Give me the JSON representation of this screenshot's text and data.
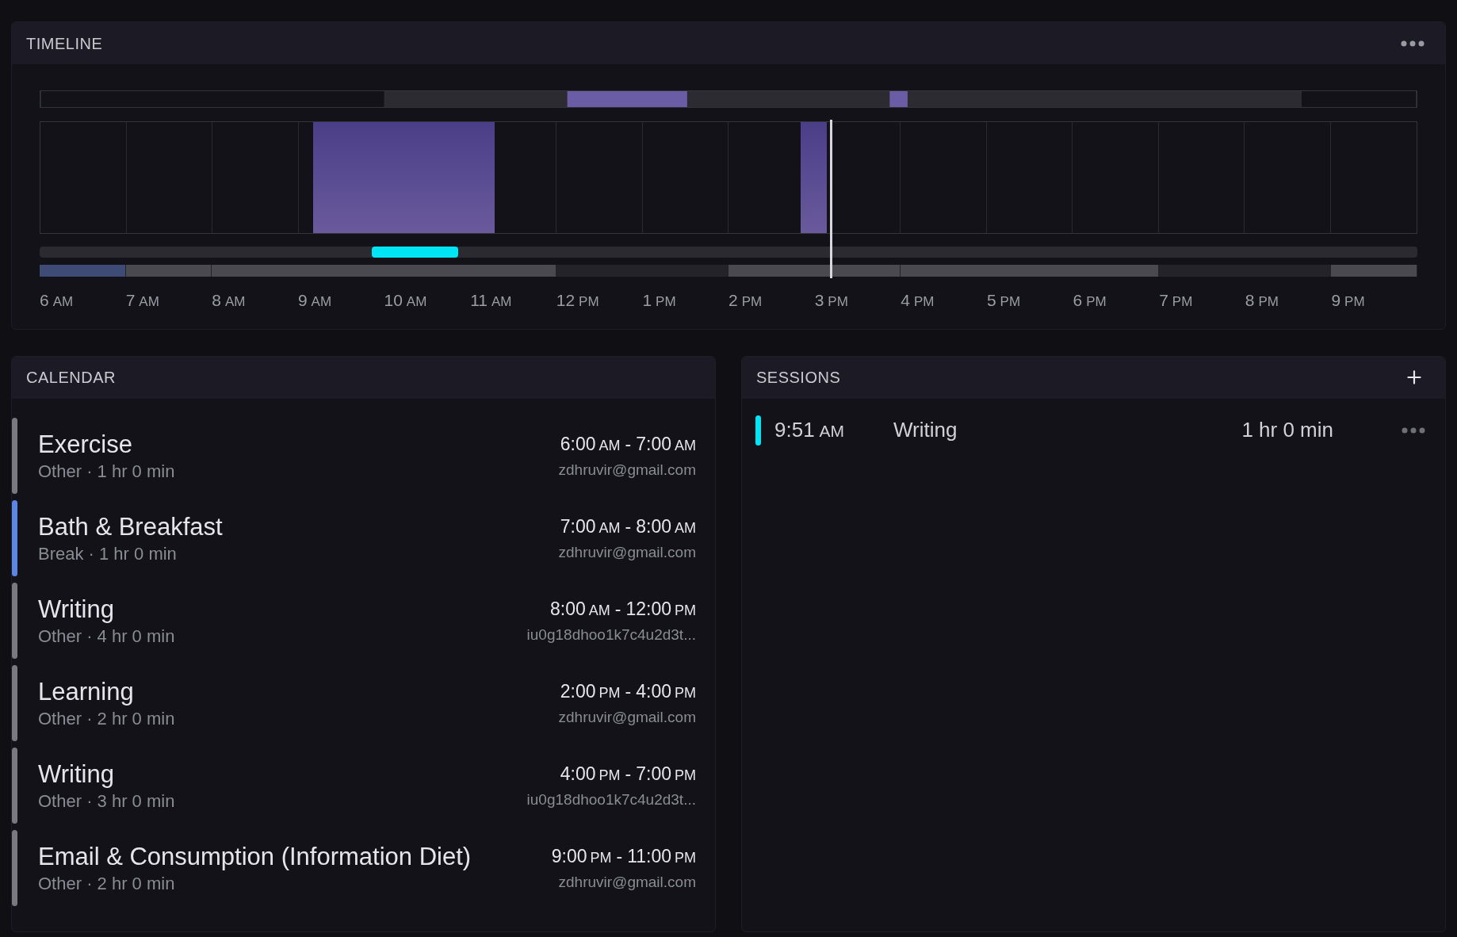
{
  "timeline": {
    "title": "TIMELINE",
    "hours": [
      {
        "hour": "6",
        "period": "AM"
      },
      {
        "hour": "7",
        "period": "AM"
      },
      {
        "hour": "8",
        "period": "AM"
      },
      {
        "hour": "9",
        "period": "AM"
      },
      {
        "hour": "10",
        "period": "AM"
      },
      {
        "hour": "11",
        "period": "AM"
      },
      {
        "hour": "12",
        "period": "PM"
      },
      {
        "hour": "1",
        "period": "PM"
      },
      {
        "hour": "2",
        "period": "PM"
      },
      {
        "hour": "3",
        "period": "PM"
      },
      {
        "hour": "4",
        "period": "PM"
      },
      {
        "hour": "5",
        "period": "PM"
      },
      {
        "hour": "6",
        "period": "PM"
      },
      {
        "hour": "7",
        "period": "PM"
      },
      {
        "hour": "8",
        "period": "PM"
      },
      {
        "hour": "9",
        "period": "PM"
      }
    ]
  },
  "calendar": {
    "title": "CALENDAR",
    "events": [
      {
        "title": "Exercise",
        "subtitle": "Other · 1 hr 0 min",
        "time": [
          {
            "kind": "num",
            "text": "6:00"
          },
          {
            "kind": "period",
            "text": "AM"
          },
          {
            "kind": "num",
            "text": "-"
          },
          {
            "kind": "num",
            "text": "7:00"
          },
          {
            "kind": "period",
            "text": "AM"
          }
        ],
        "calendar": "zdhruvir@gmail.com",
        "color": "#7a7a7e"
      },
      {
        "title": "Bath & Breakfast",
        "subtitle": "Break · 1 hr 0 min",
        "time": [
          {
            "kind": "num",
            "text": "7:00"
          },
          {
            "kind": "period",
            "text": "AM"
          },
          {
            "kind": "num",
            "text": "-"
          },
          {
            "kind": "num",
            "text": "8:00"
          },
          {
            "kind": "period",
            "text": "AM"
          }
        ],
        "calendar": "zdhruvir@gmail.com",
        "color": "#5b86e5"
      },
      {
        "title": "Writing",
        "subtitle": "Other · 4 hr 0 min",
        "time": [
          {
            "kind": "num",
            "text": "8:00"
          },
          {
            "kind": "period",
            "text": "AM"
          },
          {
            "kind": "num",
            "text": "-"
          },
          {
            "kind": "num",
            "text": "12:00"
          },
          {
            "kind": "period",
            "text": "PM"
          }
        ],
        "calendar": "iu0g18dhoo1k7c4u2d3t...",
        "color": "#7a7a7e"
      },
      {
        "title": "Learning",
        "subtitle": "Other · 2 hr 0 min",
        "time": [
          {
            "kind": "num",
            "text": "2:00"
          },
          {
            "kind": "period",
            "text": "PM"
          },
          {
            "kind": "num",
            "text": "-"
          },
          {
            "kind": "num",
            "text": "4:00"
          },
          {
            "kind": "period",
            "text": "PM"
          }
        ],
        "calendar": "zdhruvir@gmail.com",
        "color": "#7a7a7e"
      },
      {
        "title": "Writing",
        "subtitle": "Other · 3 hr 0 min",
        "time": [
          {
            "kind": "num",
            "text": "4:00"
          },
          {
            "kind": "period",
            "text": "PM"
          },
          {
            "kind": "num",
            "text": "-"
          },
          {
            "kind": "num",
            "text": "7:00"
          },
          {
            "kind": "period",
            "text": "PM"
          }
        ],
        "calendar": "iu0g18dhoo1k7c4u2d3t...",
        "color": "#7a7a7e"
      },
      {
        "title": "Email & Consumption (Information Diet)",
        "subtitle": "Other · 2 hr 0 min",
        "time": [
          {
            "kind": "num",
            "text": "9:00"
          },
          {
            "kind": "period",
            "text": "PM"
          },
          {
            "kind": "num",
            "text": "-"
          },
          {
            "kind": "num",
            "text": "11:00"
          },
          {
            "kind": "period",
            "text": "PM"
          }
        ],
        "calendar": "zdhruvir@gmail.com",
        "color": "#7a7a7e"
      }
    ]
  },
  "sessions": {
    "title": "SESSIONS",
    "items": [
      {
        "time": "9:51",
        "period": "AM",
        "title": "Writing",
        "duration": "1 hr 0 min",
        "color": "#00e5f5"
      }
    ]
  }
}
